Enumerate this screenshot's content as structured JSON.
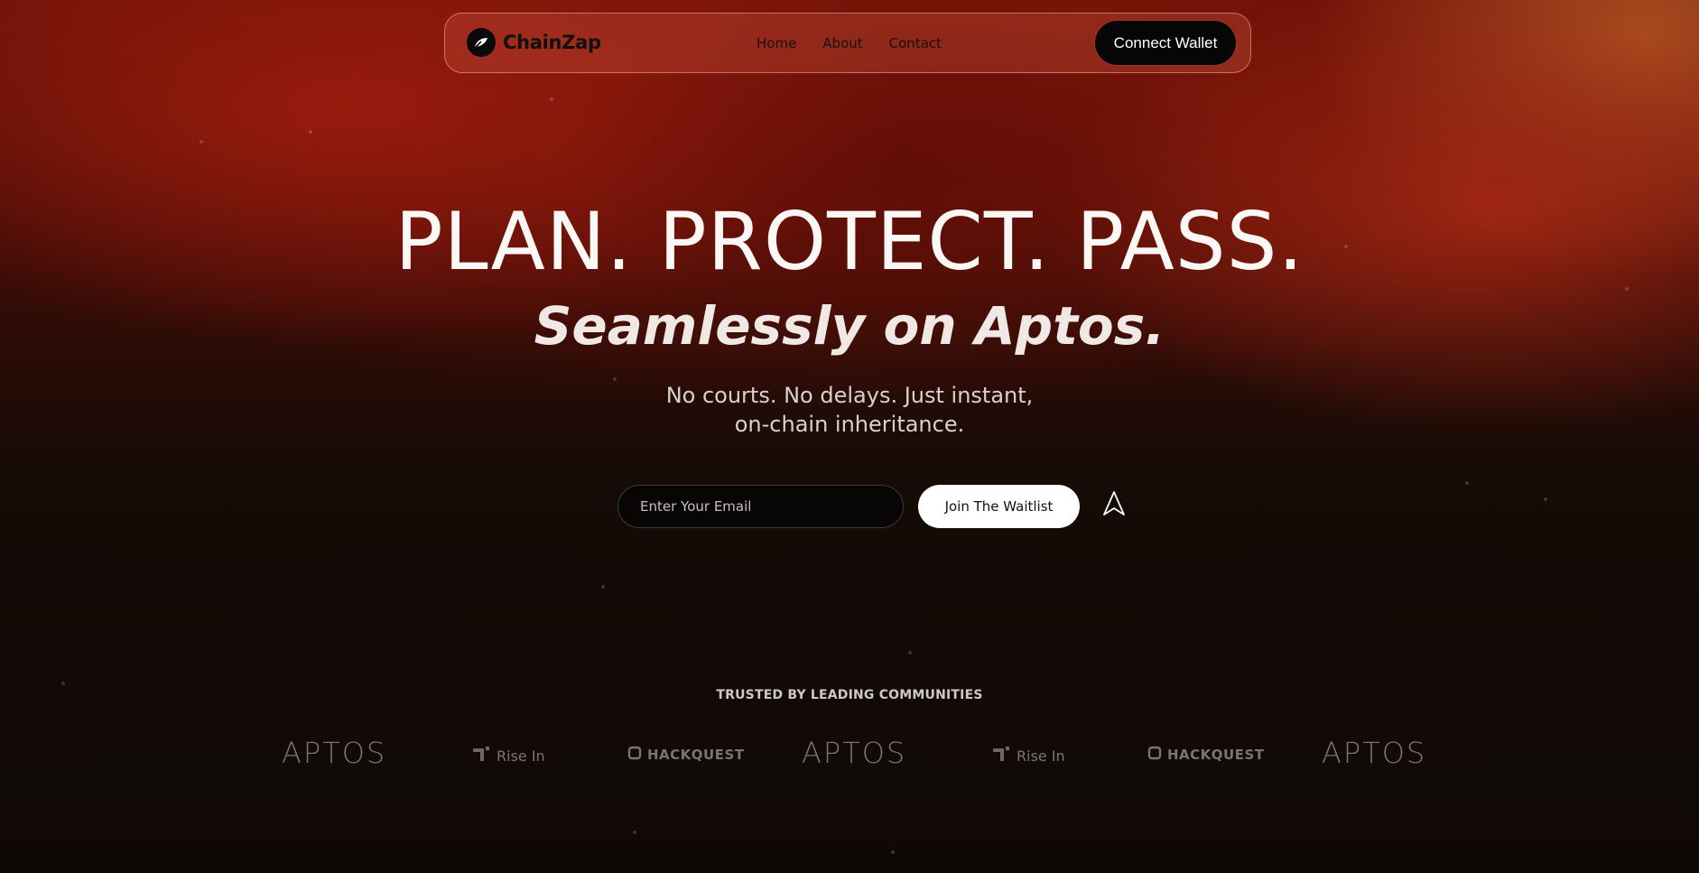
{
  "brand": {
    "name": "ChainZap"
  },
  "nav": {
    "links": [
      "Home",
      "About",
      "Contact"
    ],
    "connect_label": "Connect Wallet"
  },
  "hero": {
    "title": "PLAN. PROTECT. PASS.",
    "subtitle": "Seamlessly on Aptos.",
    "description_line1": "No courts. No delays. Just instant,",
    "description_line2": "on-chain inheritance."
  },
  "waitlist": {
    "email_placeholder": "Enter Your Email",
    "button_label": "Join The Waitlist",
    "send_icon": "send-arrow-icon"
  },
  "trusted": {
    "heading": "TRUSTED BY LEADING COMMUNITIES",
    "partners": [
      "APTOS",
      "Rise In",
      "HACKQUEST",
      "APTOS",
      "Rise In",
      "HACKQUEST",
      "APTOS"
    ]
  },
  "colors": {
    "accent_red": "#a31c0e",
    "dark_bg": "#0f0906",
    "button_dark": "#060606",
    "button_light": "#ffffff"
  }
}
